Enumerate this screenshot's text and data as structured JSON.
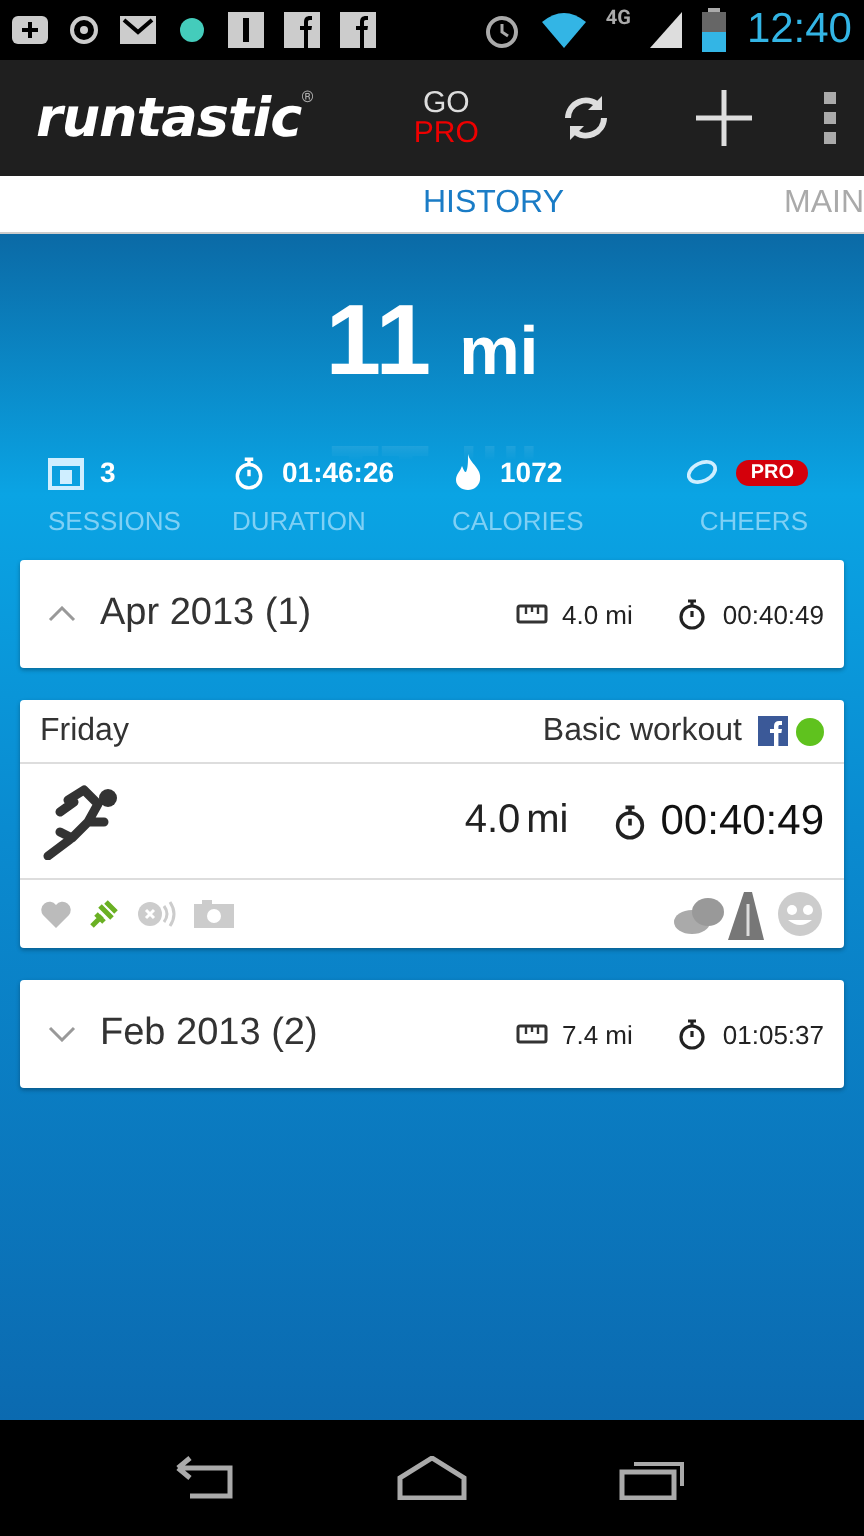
{
  "status_bar": {
    "time": "12:40",
    "network": "4G"
  },
  "action_bar": {
    "logo": "runtastic",
    "logo_mark": "®",
    "go_pro": {
      "top": "GO",
      "bottom": "PRO"
    }
  },
  "tabs": [
    {
      "label": "HISTORY",
      "selected": true
    },
    {
      "label": "MAIN",
      "selected": false
    }
  ],
  "summary": {
    "distance": "11",
    "unit": "mi",
    "stats": [
      {
        "kind": "sessions",
        "value": "3",
        "label": "SESSIONS"
      },
      {
        "kind": "duration",
        "value": "01:46:26",
        "label": "DURATION"
      },
      {
        "kind": "calories",
        "value": "1072",
        "label": "CALORIES"
      },
      {
        "kind": "cheers",
        "badge": "PRO",
        "label": "CHEERS"
      }
    ]
  },
  "months": [
    {
      "label": "Apr 2013 (1)",
      "distance": "4.0 mi",
      "duration": "00:40:49",
      "expanded": true,
      "workouts": [
        {
          "day": "Friday",
          "type": "Basic workout",
          "shared": true,
          "color": "#5fc21e",
          "distance": "4.0",
          "unit": "mi",
          "duration": "00:40:49"
        }
      ]
    },
    {
      "label": "Feb 2013 (2)",
      "distance": "7.4 mi",
      "duration": "01:05:37",
      "expanded": false
    }
  ]
}
